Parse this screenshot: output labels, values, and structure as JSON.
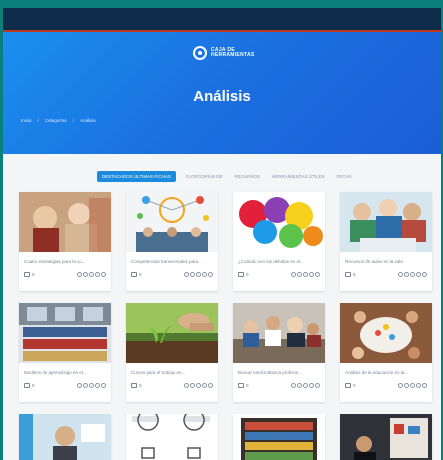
{
  "header": {
    "logo_text": "CAJA DE HERRAMIENTAS",
    "title": "Análisis",
    "breadcrumb": [
      "Inicio",
      "Categorías",
      "Análisis"
    ]
  },
  "tabs": [
    {
      "label": "DESTACADOS ÚLTIMAS FICHAS"
    },
    {
      "label": "CATEGORÍAS DE"
    },
    {
      "label": "RECURSOS"
    },
    {
      "label": "HERRAMIENTAS ÚTILES"
    },
    {
      "label": "FECHA"
    }
  ],
  "cards": [
    {
      "title": "Cuatro estrategias para la co...",
      "comments": "0",
      "theme": "people-warm"
    },
    {
      "title": "Competencias transversales para...",
      "comments": "0",
      "theme": "mindmap"
    },
    {
      "title": "¿Cuándo son las debidas en el...",
      "comments": "0",
      "theme": "bubbles"
    },
    {
      "title": "Recursos de aulas en la sala",
      "comments": "0",
      "theme": "students-laptop"
    },
    {
      "title": "Modelos de aprendizaje en el...",
      "comments": "0",
      "theme": "library"
    },
    {
      "title": "Cursos para el trabajo en...",
      "comments": "0",
      "theme": "sprout"
    },
    {
      "title": "Buscar tutoría Blanca profesor...",
      "comments": "0",
      "theme": "classroom"
    },
    {
      "title": "Análisis de la educación en la...",
      "comments": "0",
      "theme": "teamwork"
    },
    {
      "title": "",
      "comments": "",
      "theme": "teacher"
    },
    {
      "title": "",
      "comments": "",
      "theme": "bulbs"
    },
    {
      "title": "",
      "comments": "",
      "theme": "laptop-books"
    },
    {
      "title": "",
      "comments": "",
      "theme": "office"
    }
  ],
  "colors": {
    "hero_start": "#1a8ff0",
    "hero_end": "#1b5ed6",
    "topbar": "#0d2b4a",
    "accent": "#1b8be0"
  }
}
